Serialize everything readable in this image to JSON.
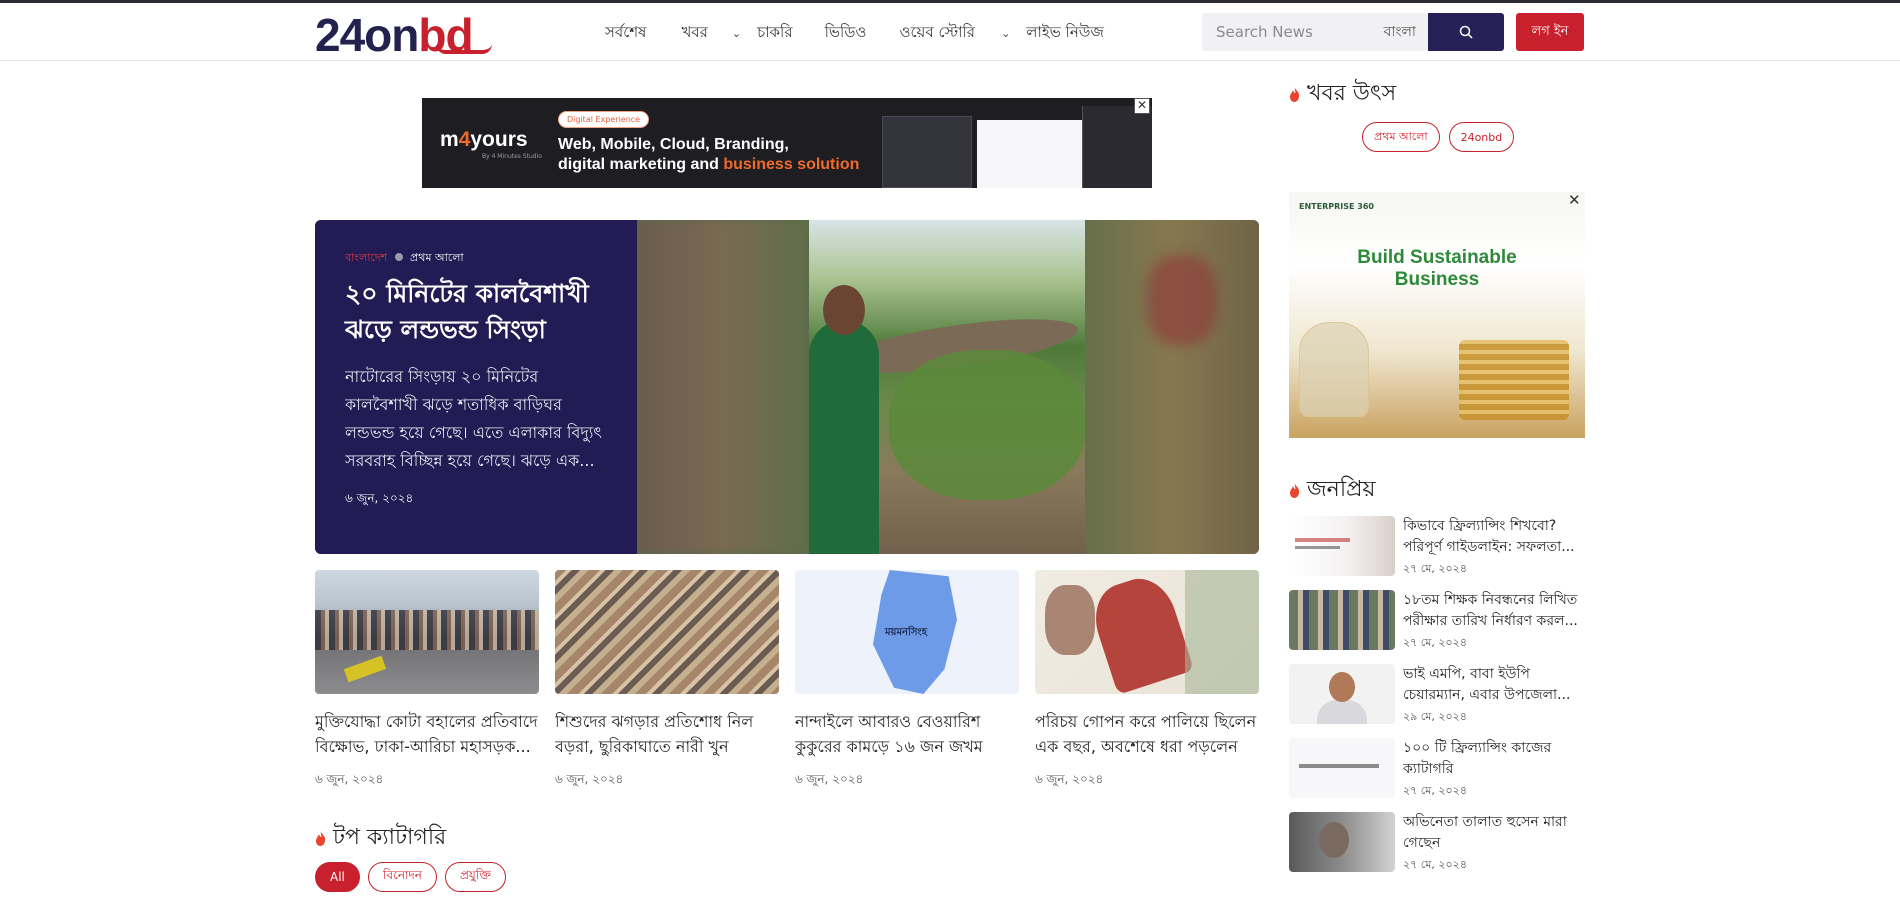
{
  "header": {
    "logo_main": "24on",
    "logo_accent": "bd",
    "nav": [
      {
        "label": "সর্বশেষ",
        "has_dropdown": false
      },
      {
        "label": "খবর",
        "has_dropdown": true
      },
      {
        "label": "চাকরি",
        "has_dropdown": false
      },
      {
        "label": "ভিডিও",
        "has_dropdown": false
      },
      {
        "label": "ওয়েব স্টোরি",
        "has_dropdown": true
      },
      {
        "label": "লাইভ নিউজ",
        "has_dropdown": false
      }
    ],
    "chevron": "⌄",
    "search_placeholder": "Search News",
    "language": "বাংলা",
    "login_label": "লগ ইন"
  },
  "banner_ad": {
    "brand": "m4yours",
    "brand_four": "4",
    "brand_sub": "By 4 Minutes Studio",
    "pill": "Digital Experience",
    "line1": "Web, Mobile, Cloud, Branding,",
    "line2_plain": "digital marketing and ",
    "line2_highlight": "business solution",
    "close": "✕"
  },
  "featured": {
    "category": "বাংলাদেশ",
    "source": "প্রথম আলো",
    "title": "২০ মিনিটের কালবৈশাখী ঝড়ে লন্ডভন্ড সিংড়া",
    "description": "নাটোরের সিংড়ায় ২০ মিনিটের কালবৈশাখী ঝড়ে শতাধিক বাড়িঘর লন্ডভন্ড হয়ে গেছে। এতে এলাকার বিদ্যুৎ সরবরাহ বিচ্ছিন্ন হয়ে গেছে। ঝড়ে এক...",
    "date": "৬ জুন, ২০২৪"
  },
  "cards": [
    {
      "title": "মুক্তিযোদ্ধা কোটা বহালের প্রতিবাদে বিক্ষোভ, ঢাকা-আরিচা মহাসড়ক...",
      "date": "৬ জুন, ২০২৪"
    },
    {
      "title": "শিশুদের ঝগড়ার প্রতিশোধ নিল বড়রা, ছুরিকাঘাতে নারী খুন",
      "date": "৬ জুন, ২০২৪"
    },
    {
      "title": "নান্দাইলে আবারও বেওয়ারিশ কুকুরের কামড়ে ১৬ জন জখম",
      "date": "৬ জুন, ২০২৪",
      "map_label": "ময়মনসিংহ"
    },
    {
      "title": "পরিচয় গোপন করে পালিয়ে ছিলেন এক বছর, অবশেষে ধরা পড়লেন",
      "date": "৬ জুন, ২০২৪"
    }
  ],
  "top_categories": {
    "heading": "টপ ক্যাটাগরি",
    "chips": [
      "All",
      "বিনোদন",
      "প্রযুক্তি"
    ],
    "active_index": 0
  },
  "sidebar": {
    "sources_heading": "খবর উৎস",
    "sources": [
      "প্রথম আলো",
      "24onbd"
    ],
    "ad": {
      "brand": "ENTERPRISE 360",
      "headline_1": "Build Sustainable",
      "headline_2": "Business",
      "close": "✕"
    },
    "popular_heading": "জনপ্রিয়",
    "popular": [
      {
        "title": "কিভাবে ফ্রিল্যান্সিং শিখবো? পরিপূর্ণ গাইডলাইন: সফলতা...",
        "date": "২৭ মে, ২০২৪"
      },
      {
        "title": "১৮তম শিক্ষক নিবন্ধনের লিখিত পরীক্ষার তারিখ নির্ধারণ করল...",
        "date": "২৭ মে, ২০২৪"
      },
      {
        "title": "ভাই এমপি, বাবা ইউপি চেয়ারম্যান, এবার উপজেলা...",
        "date": "২৯ মে, ২০২৪"
      },
      {
        "title": "১০০ টি ফ্রিল্যান্সিং কাজের ক্যাটাগরি",
        "date": "২৭ মে, ২০২৪"
      },
      {
        "title": "অভিনেতা তালাত হুসেন মারা গেছেন",
        "date": "২৭ মে, ২০২৪"
      }
    ]
  },
  "colors": {
    "brand_navy": "#23224f",
    "brand_red": "#c8202c",
    "featured_bg": "#221b54"
  }
}
